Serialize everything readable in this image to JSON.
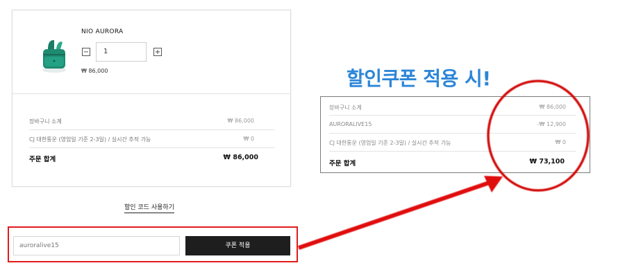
{
  "product": {
    "name": "NIO AURORA",
    "quantity": "1",
    "qty_minus": "−",
    "qty_plus": "+",
    "price": "₩ 86,000",
    "thumbnail_icon": "earbuds-case-icon"
  },
  "summary": {
    "rows": [
      {
        "label": "장바구니 소계",
        "value": "₩ 86,000"
      },
      {
        "label": "CJ 대한통운 (영업일 기준 2-3일) / 실시간 추적 가능",
        "value": "₩ 0"
      }
    ],
    "total_label": "주문 합계",
    "total_value": "₩ 86,000"
  },
  "discount": {
    "link_label": "할인 코드 사용하기",
    "input_value": "auroralive15",
    "apply_label": "쿠폰 적용"
  },
  "annotation": {
    "headline": "할인쿠폰 적용 시!",
    "highlight_color": "#e11b1b",
    "headline_color": "#2c86d8"
  },
  "result": {
    "rows": [
      {
        "label": "장바구니 소계",
        "value": "₩ 86,000"
      },
      {
        "label": "AURORALIVE15",
        "value": "-₩ 12,900"
      },
      {
        "label": "CJ 대한통운 (영업일 기준 2-3일) / 실시간 추적 가능",
        "value": "₩ 0"
      }
    ],
    "total_label": "주문 합계",
    "total_value": "₩ 73,100"
  }
}
